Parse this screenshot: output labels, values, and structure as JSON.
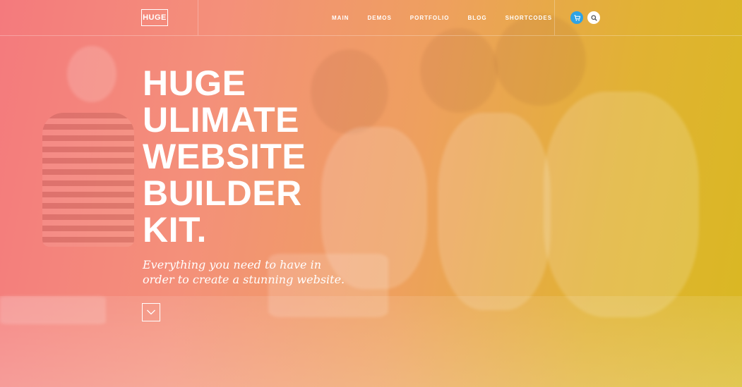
{
  "header": {
    "logo_text": "HUGE",
    "nav": [
      {
        "label": "MAIN"
      },
      {
        "label": "DEMOS"
      },
      {
        "label": "PORTFOLIO"
      },
      {
        "label": "BLOG"
      },
      {
        "label": "SHORTCODES"
      }
    ],
    "icons": {
      "cart": "cart-icon",
      "search": "search-icon"
    }
  },
  "hero": {
    "headline_lines": [
      "HUGE",
      "ULIMATE",
      "WEBSITE",
      "BUILDER",
      "KIT."
    ],
    "tagline_lines": [
      "Everything you need to have in",
      "order to create a stunning website."
    ],
    "scroll_icon": "chevron-down-icon"
  },
  "colors": {
    "gradient_left": "#f47a7d",
    "gradient_right": "#d9b822",
    "cart_button": "#2ea3e5",
    "text": "#ffffff"
  }
}
